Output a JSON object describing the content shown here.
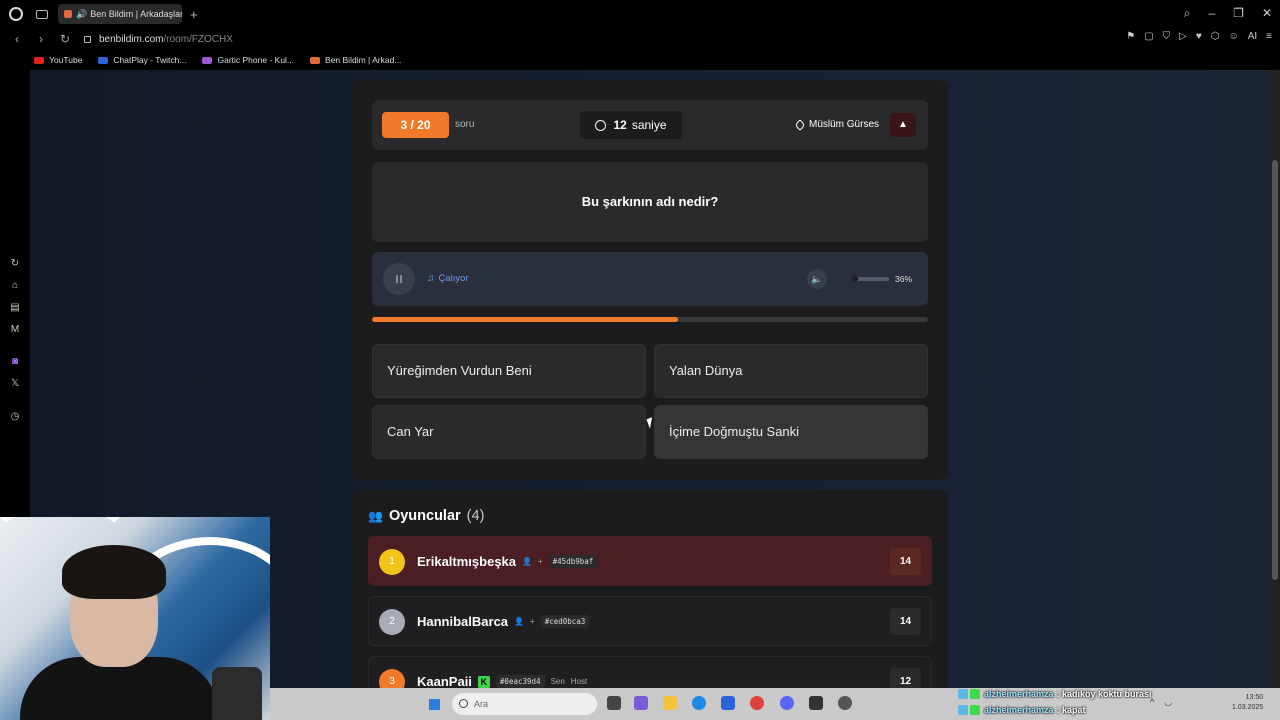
{
  "browser": {
    "tab_title": "Ben Bildim | Arkadaşlar",
    "url_domain": "benbildim.com",
    "url_path": "/room/FZOCHX",
    "bookmarks": [
      {
        "label": "YouTube",
        "color": "#e62117"
      },
      {
        "label": "ChatPlay - Twitch...",
        "color": "#2b63d9"
      },
      {
        "label": "Gartic Phone - Kul...",
        "color": "#9b59d0"
      },
      {
        "label": "Ben Bildim | Arkad...",
        "color": "#e06a3b"
      }
    ],
    "right_tools_ai": "AI"
  },
  "game": {
    "question_counter": "3 / 20",
    "question_counter_label": "soru",
    "timer_seconds": "12",
    "timer_unit": "saniye",
    "artist": "Müslüm Gürses",
    "question": "Bu şarkının adı nedir?",
    "player_status": "Çalıyor",
    "volume_percent_label": "36%",
    "volume_level": 0.36,
    "progress_fraction": 0.55,
    "answers": [
      "Yüreğimden Vurdun Beni",
      "Yalan Dünya",
      "Can Yar",
      "İçime Doğmuştu Sanki"
    ]
  },
  "players": {
    "title": "Oyuncular",
    "count_label": "(4)",
    "list": [
      {
        "rank": "1",
        "name": "Erikaltmışbeşka",
        "id": "#45db9baf",
        "score": "14",
        "rank_color": "#f2c318"
      },
      {
        "rank": "2",
        "name": "HannibalBarca",
        "id": "#ced0bca3",
        "score": "14",
        "rank_color": "#a8acb4"
      },
      {
        "rank": "3",
        "name": "KaanPaii",
        "id": "#0eac39d4",
        "score": "12",
        "rank_color": "#f07a2a",
        "you_label": "Sen",
        "host_label": "Host"
      }
    ]
  },
  "taskbar": {
    "search_placeholder": "Ara",
    "time": "13:50",
    "date": "1.03.2025"
  },
  "chat": [
    {
      "user": "alzheimerhamza",
      "message": ": kadıköy koktu burası"
    },
    {
      "user": "alzheimerhamza",
      "message": ": kapat"
    }
  ]
}
